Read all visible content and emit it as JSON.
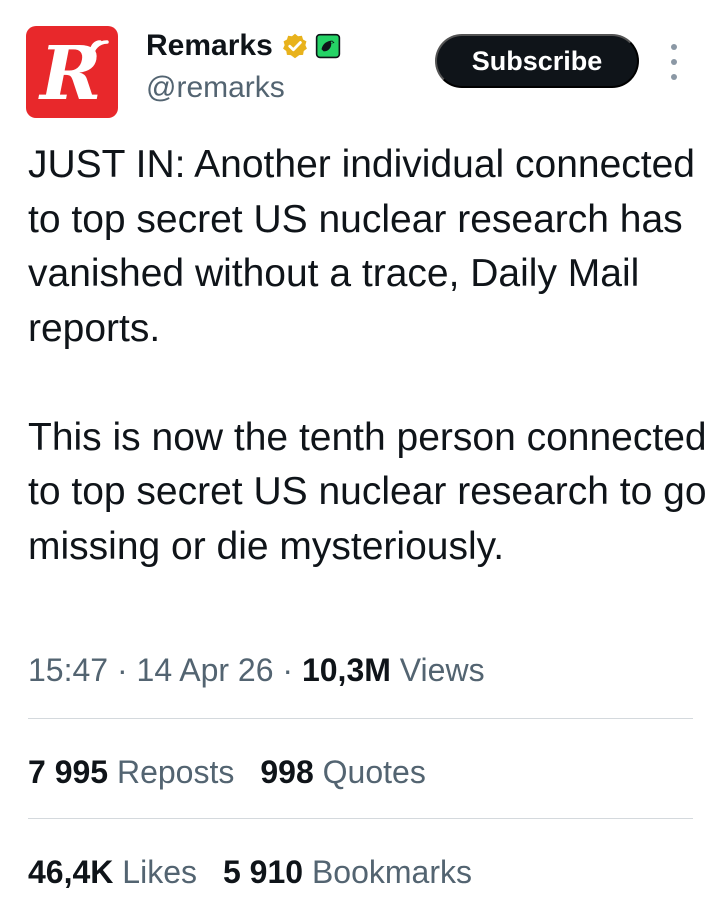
{
  "account": {
    "display_name": "Remarks",
    "handle": "@remarks",
    "avatar_letter": "R",
    "avatar_color": "#e8282b",
    "verified_color": "#e8b21c",
    "affiliate_color": "#25d366"
  },
  "header": {
    "subscribe_label": "Subscribe"
  },
  "tweet": {
    "paragraphs": [
      "JUST IN: Another individual connected to top secret US nuclear research has vanished without a trace, Daily Mail reports.",
      "This is now the tenth person connected to top secret US nuclear research to go missing or die mysteriously."
    ],
    "time": "15:47",
    "date": "14 Apr 26",
    "views_count": "10,3M",
    "views_label": "Views",
    "separator": " · "
  },
  "stats": {
    "reposts_count": "7 995",
    "reposts_label": "Reposts",
    "quotes_count": "998",
    "quotes_label": "Quotes",
    "likes_count": "46,4K",
    "likes_label": "Likes",
    "bookmarks_count": "5 910",
    "bookmarks_label": "Bookmarks"
  }
}
